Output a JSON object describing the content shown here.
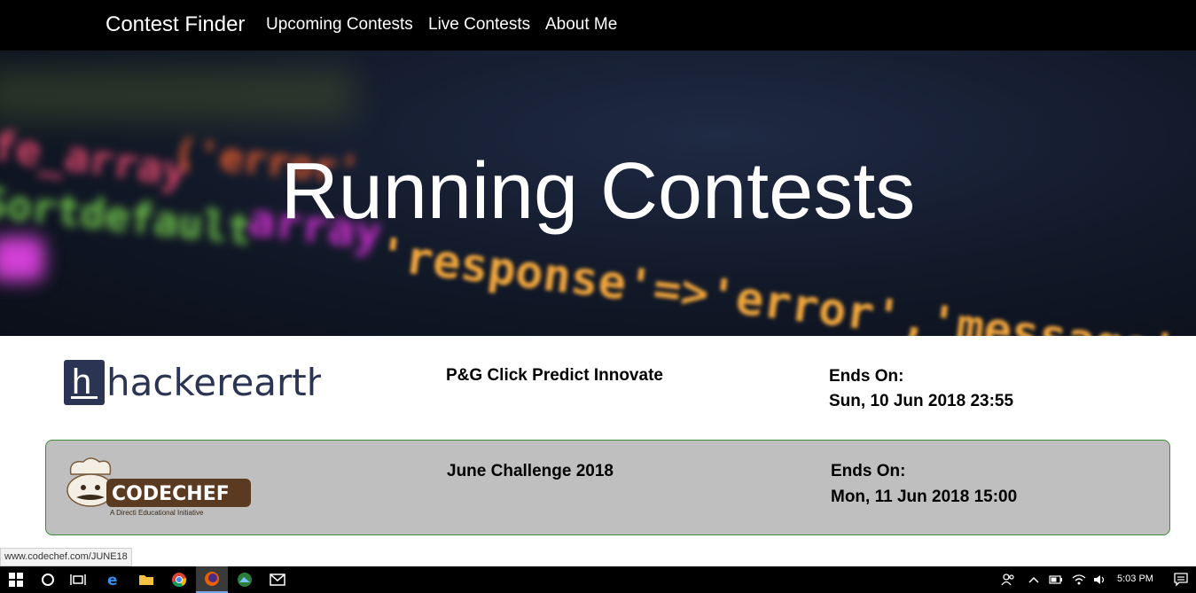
{
  "navbar": {
    "brand": "Contest Finder",
    "links": [
      "Upcoming Contests",
      "Live Contests",
      "About Me"
    ]
  },
  "hero": {
    "title": "Running Contests",
    "bg_code": [
      "'response'=>'error','message'",
      "array",
      "('error'",
      "fe_array",
      "Sortdefault"
    ]
  },
  "contests": [
    {
      "platform": "hackerearth",
      "name": "P&G Click Predict Innovate",
      "ends_label": "Ends On:",
      "ends_date": "Sun, 10 Jun 2018 23:55",
      "highlighted": false
    },
    {
      "platform": "CODECHEF",
      "platform_tagline": "A Directi Educational Initiative",
      "name": "June Challenge 2018",
      "ends_label": "Ends On:",
      "ends_date": "Mon, 11 Jun 2018 15:00",
      "highlighted": true
    }
  ],
  "status_bar": {
    "url": "www.codechef.com/JUNE18"
  },
  "taskbar": {
    "icons": [
      "windows-start-icon",
      "cortana-icon",
      "task-view-icon",
      "edge-icon",
      "file-explorer-icon",
      "chrome-icon",
      "firefox-icon",
      "photos-icon",
      "mail-icon"
    ],
    "tray_icons": [
      "people-icon",
      "chevron-up-icon",
      "battery-icon",
      "wifi-icon",
      "volume-icon"
    ],
    "time": "5:03 PM"
  },
  "colors": {
    "navbar_bg": "#000000",
    "card_highlight_bg": "#bfbfbf",
    "card_border": "#3a8d3a",
    "hackerearth_navy": "#2c3454"
  }
}
